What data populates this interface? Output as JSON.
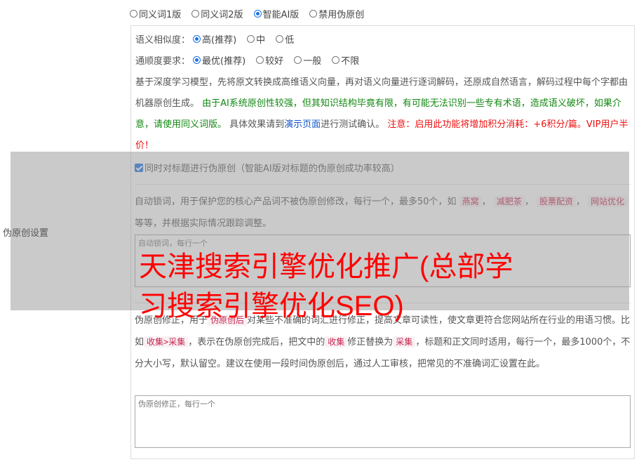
{
  "modes": [
    {
      "label": "同义词1版",
      "selected": false
    },
    {
      "label": "同义词2版",
      "selected": false
    },
    {
      "label": "智能AI版",
      "selected": true
    },
    {
      "label": "禁用伪原创",
      "selected": false
    }
  ],
  "similarity": {
    "label": "语义相似度：",
    "options": [
      {
        "label": "高(推荐)",
        "selected": true
      },
      {
        "label": "中",
        "selected": false
      },
      {
        "label": "低",
        "selected": false
      }
    ]
  },
  "fluency": {
    "label": "通顺度要求：",
    "options": [
      {
        "label": "最优(推荐)",
        "selected": true
      },
      {
        "label": "较好",
        "selected": false
      },
      {
        "label": "一般",
        "selected": false
      },
      {
        "label": "不限",
        "selected": false
      }
    ]
  },
  "description": {
    "part1": "基于深度学习模型，先将原文转换成高维语义向量，再对语义向量进行逐词解码，还原成自然语言，解码过程中每个字都由机器原创生成。",
    "green": "由于AI系统原创性较强，但其知识结构毕竟有限，有可能无法识别一些专有术语，造成语义破坏，如果介意，请使用同义词版。",
    "part2": "具体效果请到",
    "link": "演示页面",
    "part3": "进行测试确认。",
    "red": "注意：启用此功能将增加积分消耗：+6积分/篇。VIP用户半价！"
  },
  "settings_label": "伪原创设置",
  "title_check": {
    "label": "同时对标题进行伪原创（智能AI版对标题的伪原创成功率较高）",
    "checked": true
  },
  "lock": {
    "desc1": "自动锁词，用于保护您的核心产品词不被伪原创修改，每行一个，最多50个，如",
    "examples": [
      "燕窝",
      "减肥茶",
      "股票配资",
      "网站优化"
    ],
    "desc2": "等等，并根据实际情况跟踪调整。",
    "placeholder": "自动锁词，每行一个"
  },
  "fix": {
    "desc1": "伪原创修正，用于",
    "tag1": "伪原创后",
    "desc2": "对某些不准确的词汇进行修正，提高文章可读性，使文章更符合您网站所在行业的用语习惯。比如",
    "tag2": "收集>采集",
    "desc3": "，表示在伪原创完成后，把文中的",
    "tag3": "收集",
    "desc4": "修正替换为",
    "tag4": "采集",
    "desc5": "，标题和正文同时适用，每行一个，最多1000个，不分大小写，默认留空。建议在使用一段时间伪原创后，通过人工审核，把常见的不准确词汇设置在此。",
    "placeholder": "伪原创修正，每行一个"
  },
  "overlay_title": "天津搜索引擎优化推广(总部学习搜索引擎优化SEO)"
}
